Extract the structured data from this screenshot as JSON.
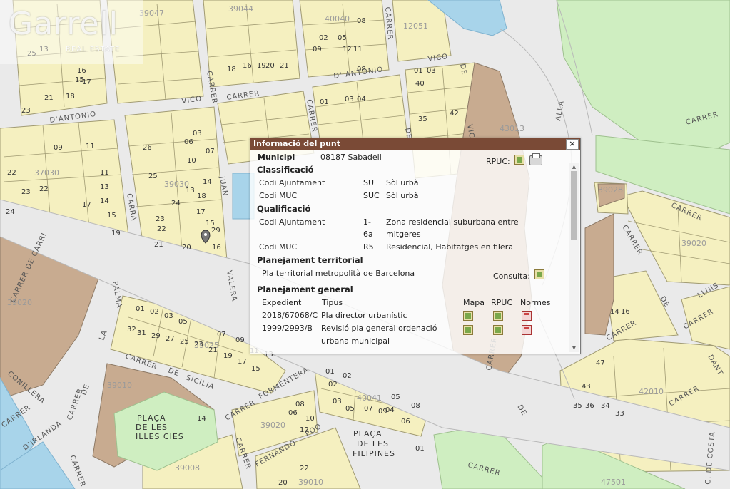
{
  "watermark": {
    "name": "Garrell",
    "sub": "REAL ESTATE"
  },
  "map": {
    "streets": [
      "CARRER",
      "CARRER",
      "D' ANTONIO",
      "VICO",
      "CARRER",
      "VICO",
      "D'ANTONIO",
      "CARRER",
      "CARRER",
      "JUAN",
      "VALERA",
      "CARRA",
      "PALMA",
      "CARRER DE CARRI",
      "CARRER",
      "DE",
      "SICILIA",
      "CARRER",
      "FORMENTERA",
      "CARRER",
      "DE",
      "LA",
      "CONILLERA",
      "CARRER",
      "D'IRLANDA",
      "CARRER",
      "DE",
      "CARRER",
      "POO",
      "FERNANDO",
      "CARRER",
      "CARRER",
      "DE",
      "CARRER",
      "LLUIS",
      "DANT",
      "C. DE COSTA",
      "CARRER",
      "CARRER",
      "DE",
      "CARRER",
      "ALLA",
      "CARRER",
      "DE",
      "VICO"
    ],
    "places": [
      "PLAÇA",
      "DE LES",
      "ILLES CIES",
      "PLAÇA",
      "DE LES",
      "FILIPINES"
    ],
    "block_codes": [
      "39047",
      "39044",
      "40040",
      "12051",
      "37030",
      "39020",
      "39010",
      "39025",
      "39030",
      "40041",
      "39008",
      "39010",
      "42010",
      "47501",
      "39028",
      "39020",
      "43013",
      "39020"
    ],
    "plot_numbers": [
      "25",
      "17",
      "16",
      "23",
      "21",
      "18",
      "09",
      "11",
      "15",
      "22",
      "23",
      "19",
      "17",
      "13",
      "12",
      "11",
      "08",
      "05",
      "02",
      "09",
      "03",
      "04",
      "01",
      "26",
      "25",
      "24",
      "23",
      "22",
      "21",
      "20",
      "29",
      "16",
      "13",
      "15",
      "17",
      "18",
      "14",
      "10",
      "07",
      "06",
      "03",
      "43",
      "47",
      "33",
      "34",
      "36",
      "35",
      "16",
      "14",
      "01",
      "02",
      "03",
      "05",
      "07",
      "09",
      "11",
      "13",
      "15",
      "17",
      "19",
      "21",
      "23",
      "25",
      "27",
      "29",
      "31",
      "32",
      "22",
      "20",
      "06",
      "10",
      "12",
      "08",
      "01",
      "02",
      "05",
      "04",
      "01",
      "02",
      "03",
      "05",
      "07",
      "09",
      "08",
      "06",
      "14",
      "01",
      "03",
      "40",
      "35",
      "42",
      "09",
      "24",
      "22",
      "08",
      "11",
      "13",
      "14",
      "15",
      "16",
      "18",
      "19",
      "20",
      "21"
    ]
  },
  "popup": {
    "title": "Informació del punt",
    "close": "×",
    "municipi_label": "Municipi",
    "municipi_value": "08187 Sabadell",
    "rpuc_label": "RPUC:",
    "classificacio": {
      "title": "Classificació",
      "rows": [
        {
          "label": "Codi Ajuntament",
          "code": "SU",
          "desc": "Sòl urbà"
        },
        {
          "label": "Codi MUC",
          "code": "SUC",
          "desc": "Sòl urbà"
        }
      ]
    },
    "qualificacio": {
      "title": "Qualificació",
      "rows": [
        {
          "label": "Codi Ajuntament",
          "code1": "1-",
          "code2": "6a",
          "desc1": "Zona residencial suburbana entre",
          "desc2": "mitgeres"
        },
        {
          "label": "Codi MUC",
          "code": "R5",
          "desc": "Residencial, Habitatges en filera"
        }
      ]
    },
    "planejament_territorial": {
      "title": "Planejament territorial",
      "value": "Pla territorial metropolità de Barcelona",
      "consulta_label": "Consulta:"
    },
    "planejament_general": {
      "title": "Planejament general",
      "headers": {
        "expedient": "Expedient",
        "tipus": "Tipus",
        "mapa": "Mapa",
        "rpuc": "RPUC",
        "normes": "Normes"
      },
      "rows": [
        {
          "expedient": "2018/67068/C",
          "tipus": "Pla director urbanístic",
          "tipus2": ""
        },
        {
          "expedient": "1999/2993/B",
          "tipus": "Revisió pla general ordenació",
          "tipus2": "urbana municipal"
        }
      ]
    }
  },
  "colors": {
    "plot": "#f5f0c0",
    "plot_outline": "#a09a72",
    "street": "#e9e9e9",
    "street_outline": "#b8b8b8",
    "facility": "#c8ab90",
    "green": "#cfeec1",
    "water": "#a8d4ea",
    "popup_header": "#7a4a36"
  }
}
